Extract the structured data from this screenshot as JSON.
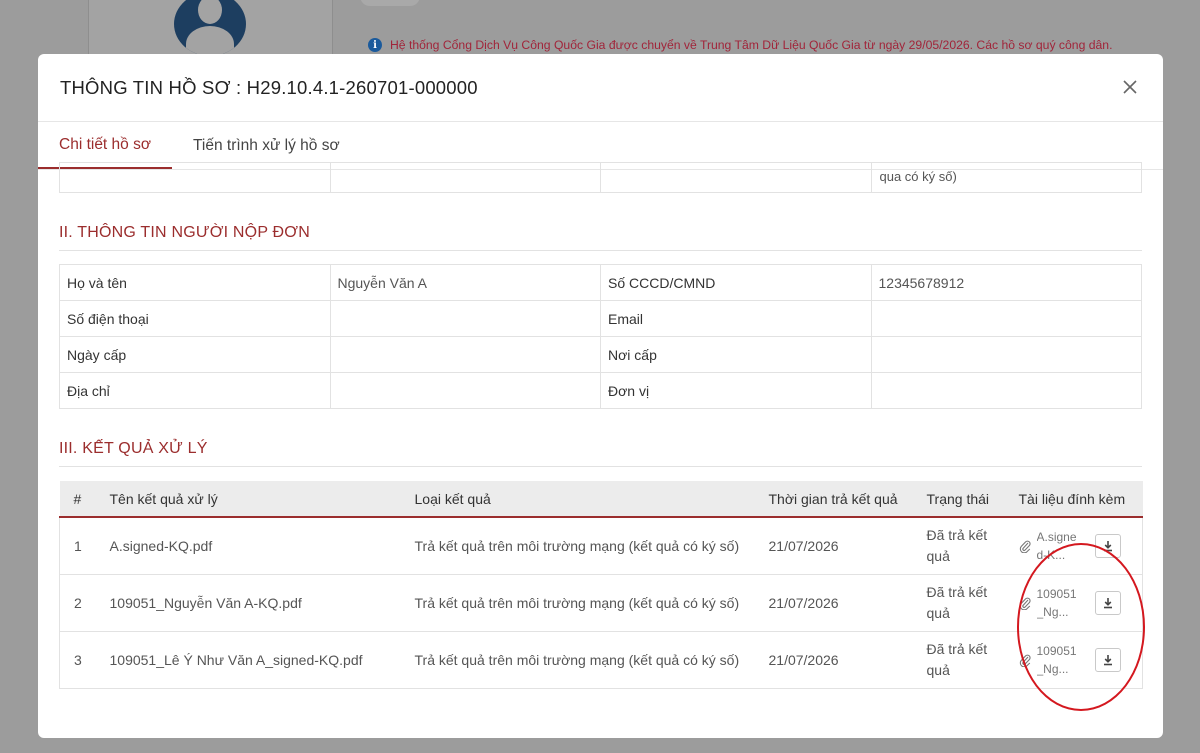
{
  "background": {
    "notice": "Hệ thống Cổng Dịch Vụ Công Quốc Gia được chuyển về Trung Tâm Dữ Liệu Quốc Gia từ ngày 29/05/2026. Các hồ sơ quý công dân."
  },
  "modal": {
    "title": "THÔNG TIN HỒ SƠ : H29.10.4.1-260701-000000",
    "tabs": [
      {
        "label": "Chi tiết hồ sơ",
        "active": true
      },
      {
        "label": "Tiến trình xử lý hồ sơ",
        "active": false
      }
    ],
    "partial_row_text": "qua có ký số)",
    "section2": {
      "title": "II. THÔNG TIN NGƯỜI NỘP ĐƠN",
      "rows": [
        {
          "label1": "Họ và tên",
          "value1": "Nguyễn Văn A",
          "label2": "Số CCCD/CMND",
          "value2": "12345678912"
        },
        {
          "label1": "Số điện thoại",
          "value1": "",
          "label2": "Email",
          "value2": ""
        },
        {
          "label1": "Ngày cấp",
          "value1": "",
          "label2": "Nơi cấp",
          "value2": ""
        },
        {
          "label1": "Địa chỉ",
          "value1": "",
          "label2": "Đơn vị",
          "value2": ""
        }
      ]
    },
    "section3": {
      "title": "III. KẾT QUẢ XỬ LÝ",
      "columns": [
        "#",
        "Tên kết quả xử lý",
        "Loại kết quả",
        "Thời gian trả kết quả",
        "Trạng thái",
        "Tài liệu đính kèm"
      ],
      "rows": [
        {
          "index": "1",
          "name": "A.signed-KQ.pdf",
          "type": "Trả kết quả trên môi trường mạng (kết quả có ký số)",
          "time": "21/07/2026",
          "status": "Đã trả kết quả",
          "attachment": "A.signed-K..."
        },
        {
          "index": "2",
          "name": "109051_Nguyễn Văn A-KQ.pdf",
          "type": "Trả kết quả trên môi trường mạng (kết quả có ký số)",
          "time": "21/07/2026",
          "status": "Đã trả kết quả",
          "attachment": "109051_Ng..."
        },
        {
          "index": "3",
          "name": "109051_Lê Ý Như Văn A_signed-KQ.pdf",
          "type": "Trả kết quả trên môi trường mạng (kết quả có ký số)",
          "time": "21/07/2026",
          "status": "Đã trả kết quả",
          "attachment": "109051_Ng..."
        }
      ]
    }
  },
  "colors": {
    "accent": "#9b2d2d",
    "highlight_ellipse": "#d4181f",
    "notice_text": "#a1253a"
  },
  "icons": [
    "info-icon",
    "user-avatar-icon",
    "close-icon",
    "paperclip-icon",
    "download-icon"
  ]
}
